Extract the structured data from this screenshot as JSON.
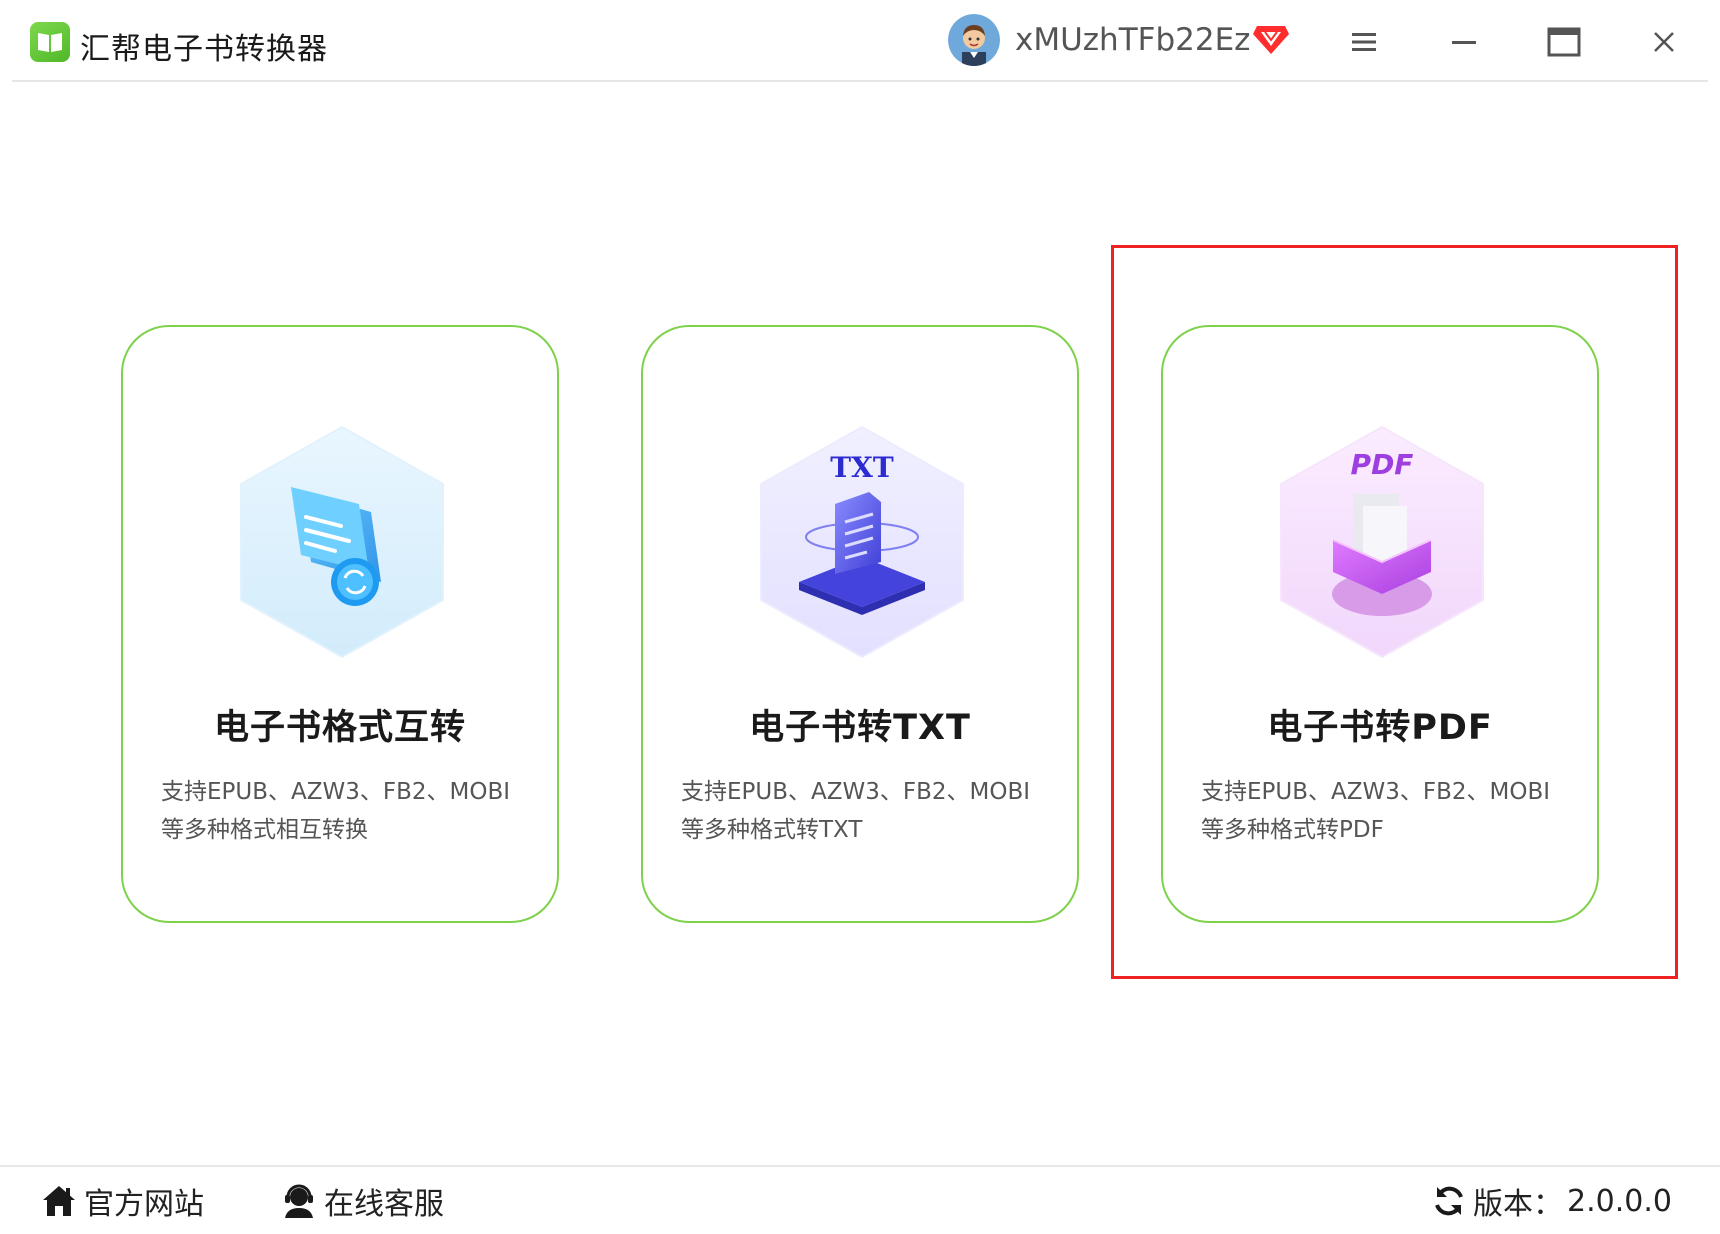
{
  "app": {
    "title": "汇帮电子书转换器",
    "username": "xMUzhTFb22Ez",
    "brand_color": "#5cc231",
    "highlight_color": "#ee2222"
  },
  "window_controls": {
    "menu_icon": "hamburger-menu-icon",
    "minimize_icon": "minimize-icon",
    "maximize_icon": "maximize-icon",
    "close_icon": "close-icon"
  },
  "cards": [
    {
      "icon": "ebook-format-convert-icon",
      "title": "电子书格式互转",
      "desc_line1": "支持EPUB、AZW3、FB2、MOBI",
      "desc_line2": "等多种格式相互转换"
    },
    {
      "icon": "txt-document-icon",
      "icon_text": "TXT",
      "title": "电子书转TXT",
      "desc_line1": "支持EPUB、AZW3、FB2、MOBI",
      "desc_line2": "等多种格式转TXT"
    },
    {
      "icon": "pdf-document-icon",
      "icon_text": "PDF",
      "title": "电子书转PDF",
      "desc_line1": "支持EPUB、AZW3、FB2、MOBI",
      "desc_line2": "等多种格式转PDF"
    }
  ],
  "footer": {
    "site_label": "官方网站",
    "service_label": "在线客服",
    "version_label": "版本：",
    "version_value": "2.0.0.0"
  }
}
